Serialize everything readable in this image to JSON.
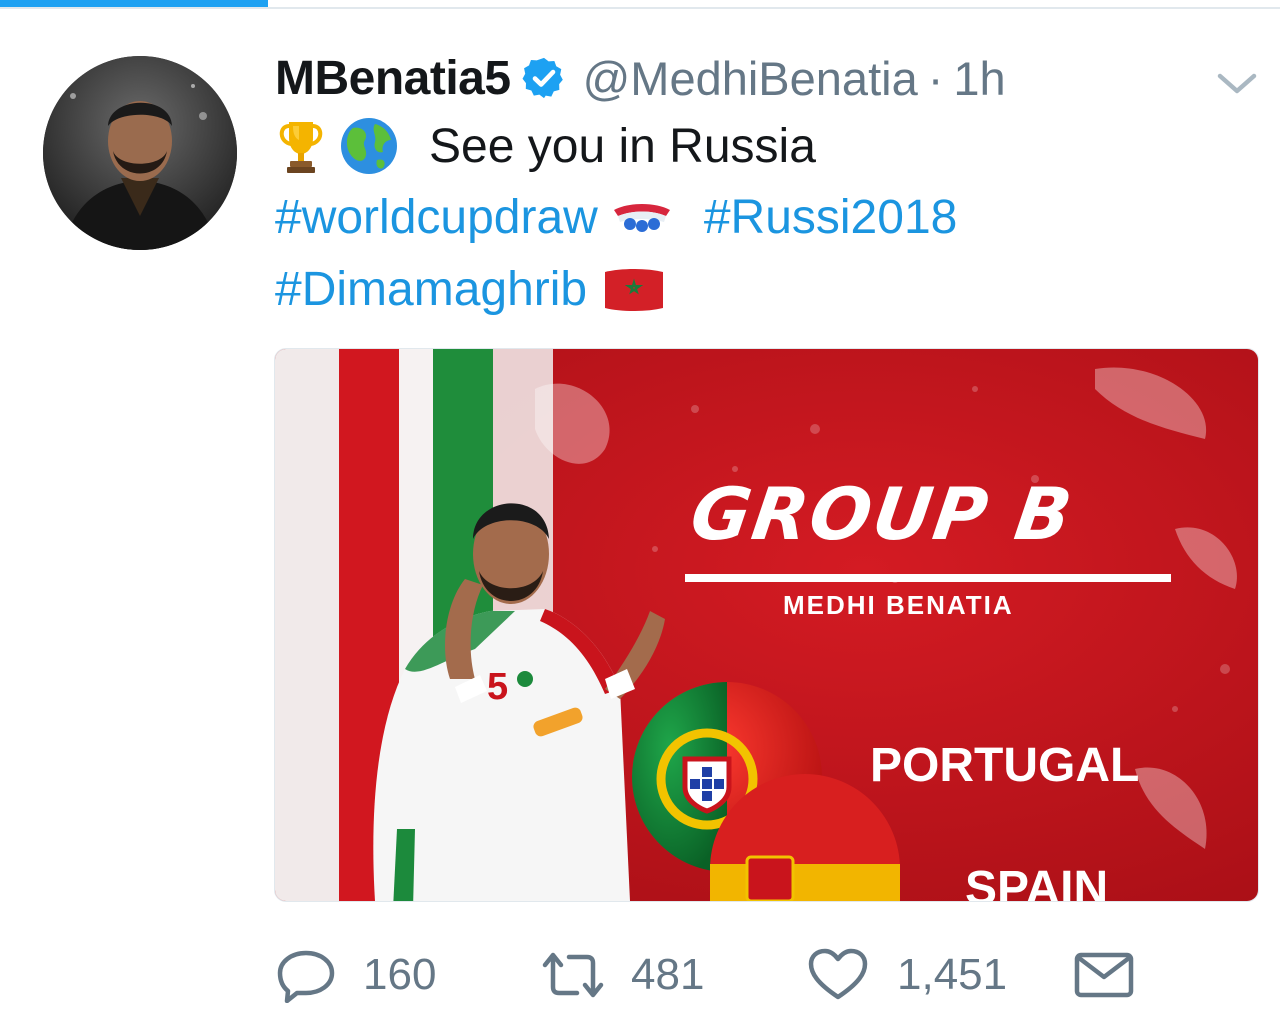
{
  "tweet": {
    "display_name": "MBenatia5",
    "handle": "@MedhiBenatia",
    "separator": "·",
    "time": "1h",
    "text": "See you in Russia",
    "emojis_line1": [
      "trophy-emoji",
      "globe-emoji"
    ],
    "hashtags": [
      "#worldcupdraw",
      "#Russi2018",
      "#Dimamaghrib"
    ]
  },
  "media": {
    "title": "GROUP B",
    "player_name": "MEDHI BENATIA",
    "jersey_number": "5",
    "teams": [
      "PORTUGAL",
      "SPAIN"
    ]
  },
  "actions": {
    "replies": "160",
    "retweets": "481",
    "likes": "1,451"
  },
  "colors": {
    "link": "#1b95e0",
    "verified": "#1da1f2",
    "muted": "#657786",
    "banner_red": "#c8141c"
  }
}
